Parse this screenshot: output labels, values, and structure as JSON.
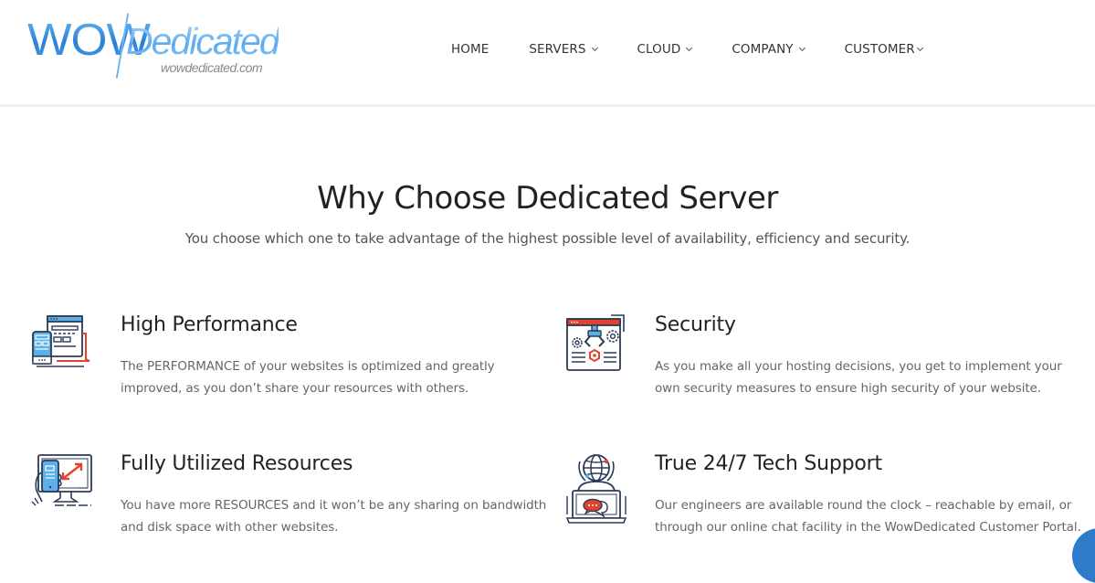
{
  "header": {
    "logo": {
      "brand_part1": "WOW",
      "brand_part2": "Dedicated",
      "url": "wowdedicated.com"
    },
    "nav": [
      {
        "label": "HOME",
        "has_dropdown": false
      },
      {
        "label": "SERVERS",
        "has_dropdown": true
      },
      {
        "label": "CLOUD",
        "has_dropdown": true
      },
      {
        "label": "COMPANY",
        "has_dropdown": true
      },
      {
        "label": "CUSTOMER",
        "has_dropdown": true
      }
    ]
  },
  "section": {
    "title": "Why Choose Dedicated Server",
    "subtitle": "You choose which one to take advantage of the highest possible level of availability, efficiency and security."
  },
  "features": [
    {
      "icon": "devices-icon",
      "title": "High Performance",
      "desc_line1": "The PERFORMANCE of your websites is optimized and greatly",
      "desc_line2": "improved, as you don’t share your resources with others."
    },
    {
      "icon": "security-robot-icon",
      "title": "Security",
      "desc_line1": "As you make all your hosting decisions, you get to implement your",
      "desc_line2": "own security measures to ensure high security of your website."
    },
    {
      "icon": "resize-screen-icon",
      "title": "Fully Utilized Resources",
      "desc_line1": "You have more RESOURCES and it won’t be any sharing on bandwidth",
      "desc_line2": "and disk space with other websites."
    },
    {
      "icon": "support-globe-chat-icon",
      "title": "True 24/7 Tech Support",
      "desc_line1": "Our engineers are available round the clock – reachable by email, or",
      "desc_line2": "through our online chat facility in the WowDedicated Customer Portal."
    }
  ],
  "colors": {
    "brand_blue": "#2a80d2",
    "icon_navy": "#2b3a55",
    "icon_blue": "#5ab0e8",
    "icon_red": "#e0452b",
    "chat_widget": "#2e7bc9"
  }
}
